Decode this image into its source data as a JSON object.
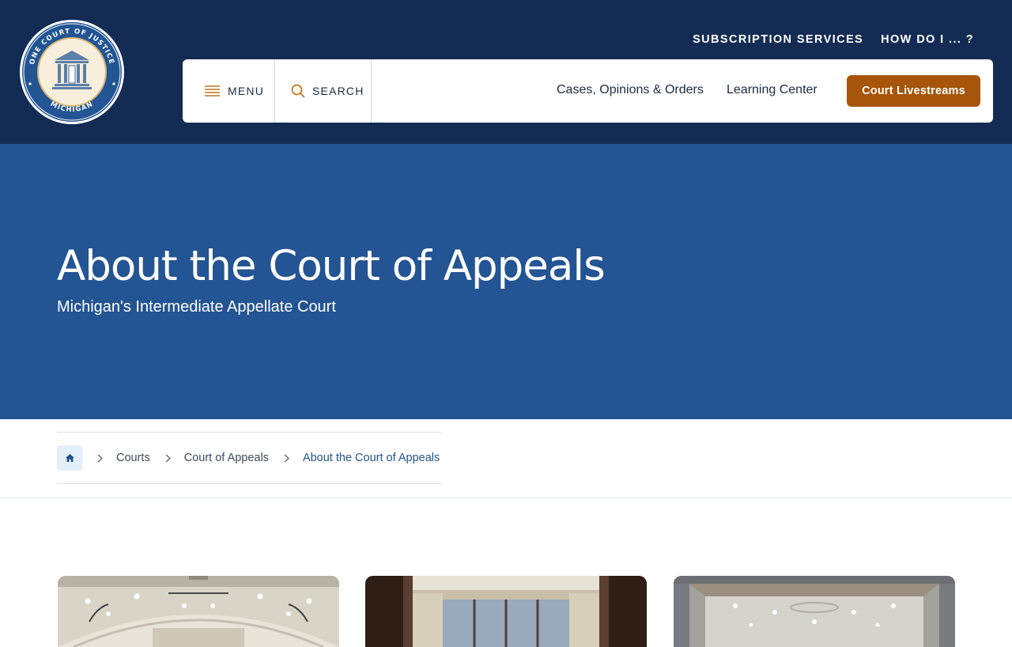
{
  "logo": {
    "ring_text_top": "ONE COURT OF JUSTICE",
    "ring_text_bottom": "MICHIGAN",
    "icon": "courthouse-icon"
  },
  "utility_nav": {
    "subscription": "SUBSCRIPTION SERVICES",
    "how_do_i": "HOW DO I ... ?"
  },
  "main_nav": {
    "menu_label": "MENU",
    "menu_icon": "hamburger-icon",
    "search_label": "SEARCH",
    "search_icon": "search-icon",
    "links": [
      "Cases, Opinions & Orders",
      "Learning Center"
    ],
    "livestream_button": "Court Livestreams"
  },
  "hero": {
    "title": "About the Court of Appeals",
    "subtitle": "Michigan's Intermediate Appellate Court"
  },
  "breadcrumb": {
    "home_icon": "home-icon",
    "items": [
      "Courts",
      "Court of Appeals",
      "About the Court of Appeals"
    ]
  },
  "colors": {
    "header_bg": "#142c54",
    "hero_bg": "#235493",
    "accent": "#a7550a",
    "breadcrumb_active": "#23558f"
  }
}
